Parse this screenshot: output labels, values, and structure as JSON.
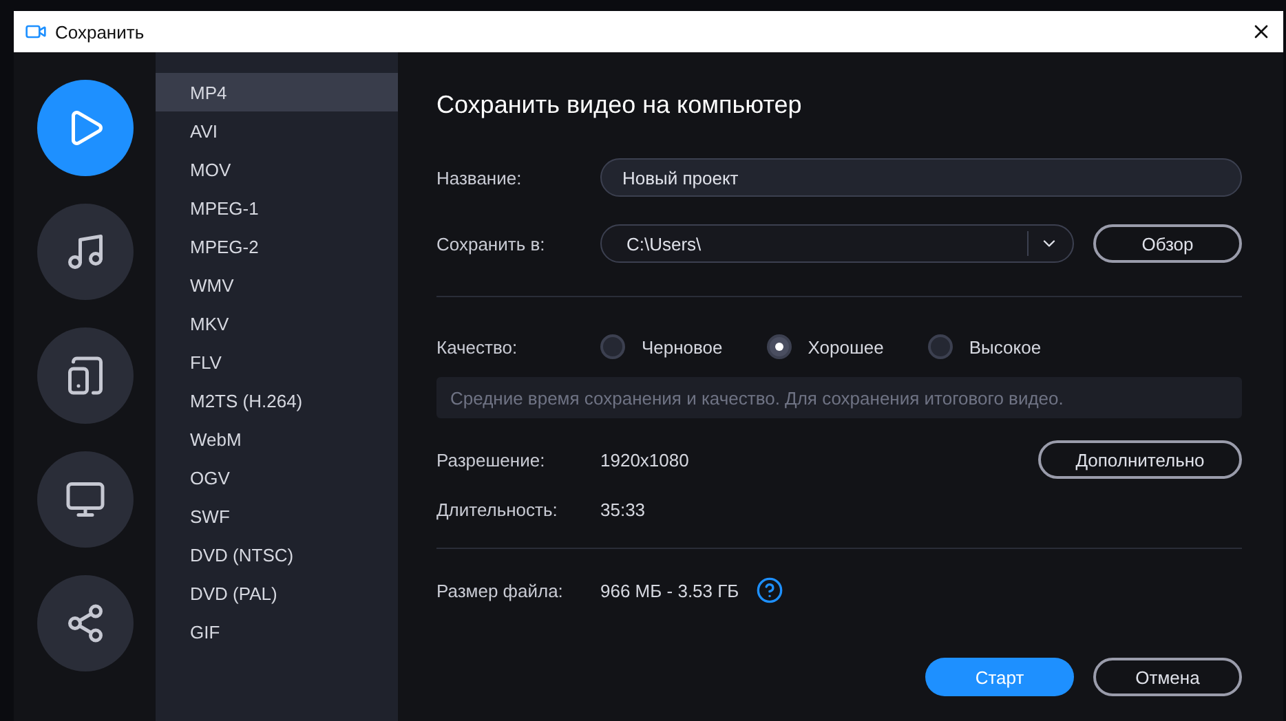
{
  "window": {
    "title": "Сохранить"
  },
  "categories": [
    {
      "kind": "video",
      "selected": true
    },
    {
      "kind": "audio",
      "selected": false
    },
    {
      "kind": "devices",
      "selected": false
    },
    {
      "kind": "tv",
      "selected": false
    },
    {
      "kind": "share",
      "selected": false
    }
  ],
  "formats": [
    {
      "label": "MP4",
      "selected": true
    },
    {
      "label": "AVI",
      "selected": false
    },
    {
      "label": "MOV",
      "selected": false
    },
    {
      "label": "MPEG-1",
      "selected": false
    },
    {
      "label": "MPEG-2",
      "selected": false
    },
    {
      "label": "WMV",
      "selected": false
    },
    {
      "label": "MKV",
      "selected": false
    },
    {
      "label": "FLV",
      "selected": false
    },
    {
      "label": "M2TS (H.264)",
      "selected": false
    },
    {
      "label": "WebM",
      "selected": false
    },
    {
      "label": "OGV",
      "selected": false
    },
    {
      "label": "SWF",
      "selected": false
    },
    {
      "label": "DVD (NTSC)",
      "selected": false
    },
    {
      "label": "DVD (PAL)",
      "selected": false
    },
    {
      "label": "GIF",
      "selected": false
    }
  ],
  "panel": {
    "heading": "Сохранить видео на компьютер",
    "name_field": {
      "label": "Название:",
      "value": "Новый проект"
    },
    "folder_field": {
      "label": "Сохранить в:",
      "value": "C:\\Users\\",
      "browse_button": "Обзор"
    },
    "quality": {
      "label": "Качество:",
      "options": [
        {
          "label": "Черновое",
          "selected": false
        },
        {
          "label": "Хорошее",
          "selected": true
        },
        {
          "label": "Высокое",
          "selected": false
        }
      ],
      "hint": "Средние время сохранения и качество. Для сохранения итогового видео."
    },
    "resolution": {
      "label": "Разрешение:",
      "value": "1920x1080"
    },
    "advanced_button": "Дополнительно",
    "duration": {
      "label": "Длительность:",
      "value": "35:33"
    },
    "file_size": {
      "label": "Размер файла:",
      "value": "966 МБ - 3.53 ГБ"
    },
    "buttons": [
      {
        "label": "Старт",
        "kind": "primary"
      },
      {
        "label": "Отмена",
        "kind": "secondary"
      }
    ]
  }
}
